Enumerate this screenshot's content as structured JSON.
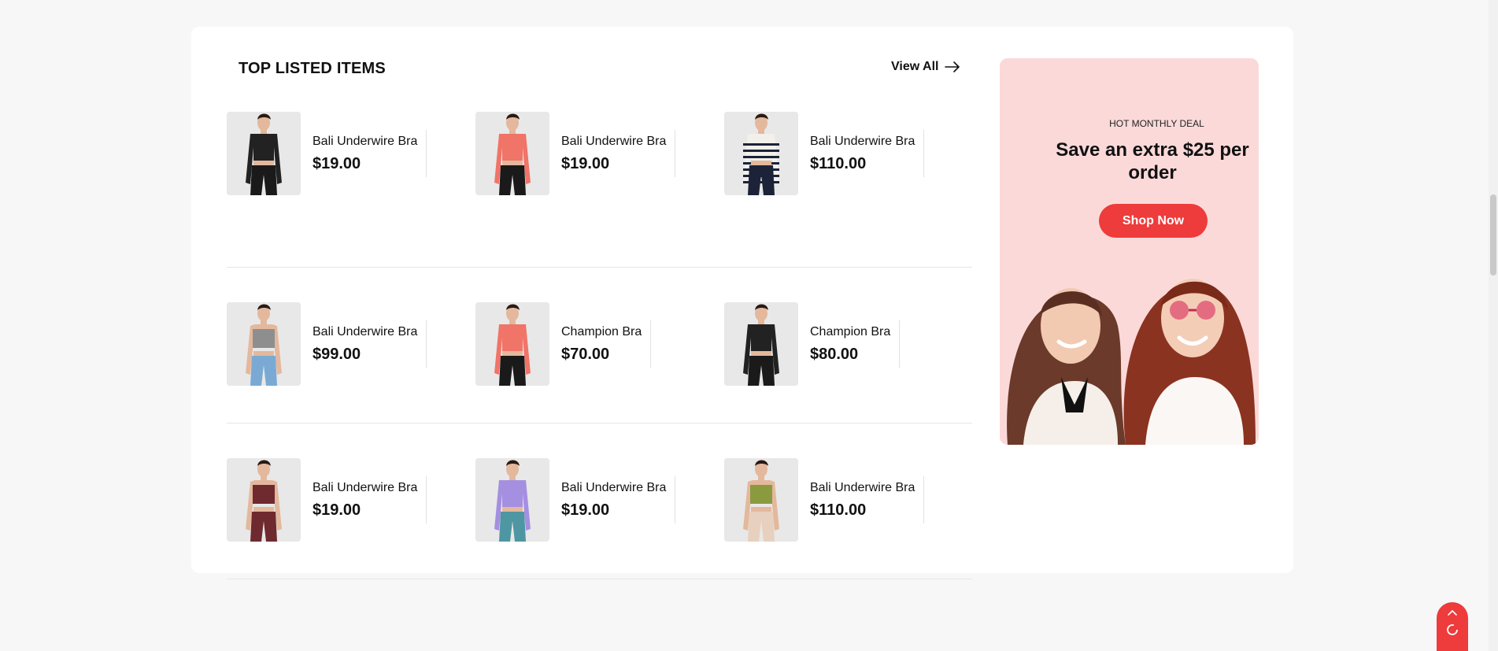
{
  "section": {
    "title": "TOP LISTED ITEMS",
    "view_all": "View All"
  },
  "products": [
    {
      "name": "Bali Underwire Bra",
      "price": "$19.00",
      "top_color": "#222222",
      "bottom_color": "#1a1a1a",
      "style": "longsleeve"
    },
    {
      "name": "Bali Underwire Bra",
      "price": "$19.00",
      "top_color": "#f07468",
      "bottom_color": "#1a1a1a",
      "style": "longsleeve"
    },
    {
      "name": "Bali Underwire Bra",
      "price": "$110.00",
      "top_color": "#f2f0ea",
      "bottom_color": "#1c2338",
      "style": "striped"
    },
    {
      "name": "Bali Underwire Bra",
      "price": "$99.00",
      "top_color": "#8e8e8e",
      "bottom_color": "#7aaad4",
      "style": "bra"
    },
    {
      "name": "Champion Bra",
      "price": "$70.00",
      "top_color": "#f07468",
      "bottom_color": "#1a1a1a",
      "style": "longsleeve"
    },
    {
      "name": "Champion Bra",
      "price": "$80.00",
      "top_color": "#222222",
      "bottom_color": "#1a1a1a",
      "style": "longsleeve"
    },
    {
      "name": "Bali Underwire Bra",
      "price": "$19.00",
      "top_color": "#6e2a2e",
      "bottom_color": "#6e2a2e",
      "style": "bra"
    },
    {
      "name": "Bali Underwire Bra",
      "price": "$19.00",
      "top_color": "#a58fe0",
      "bottom_color": "#4f96a3",
      "style": "longsleeve"
    },
    {
      "name": "Bali Underwire Bra",
      "price": "$110.00",
      "top_color": "#8a9a3e",
      "bottom_color": "#e8d0bf",
      "style": "bra"
    }
  ],
  "promo": {
    "kicker": "HOT MONTHLY DEAL",
    "title": "Save an extra $25 per order",
    "button": "Shop Now",
    "bg_color": "#fcd9d9",
    "accent_color": "#ee3b3b"
  },
  "icons": {
    "view_all": "arrow-right-icon",
    "back_to_top": "chevron-up-icon"
  }
}
